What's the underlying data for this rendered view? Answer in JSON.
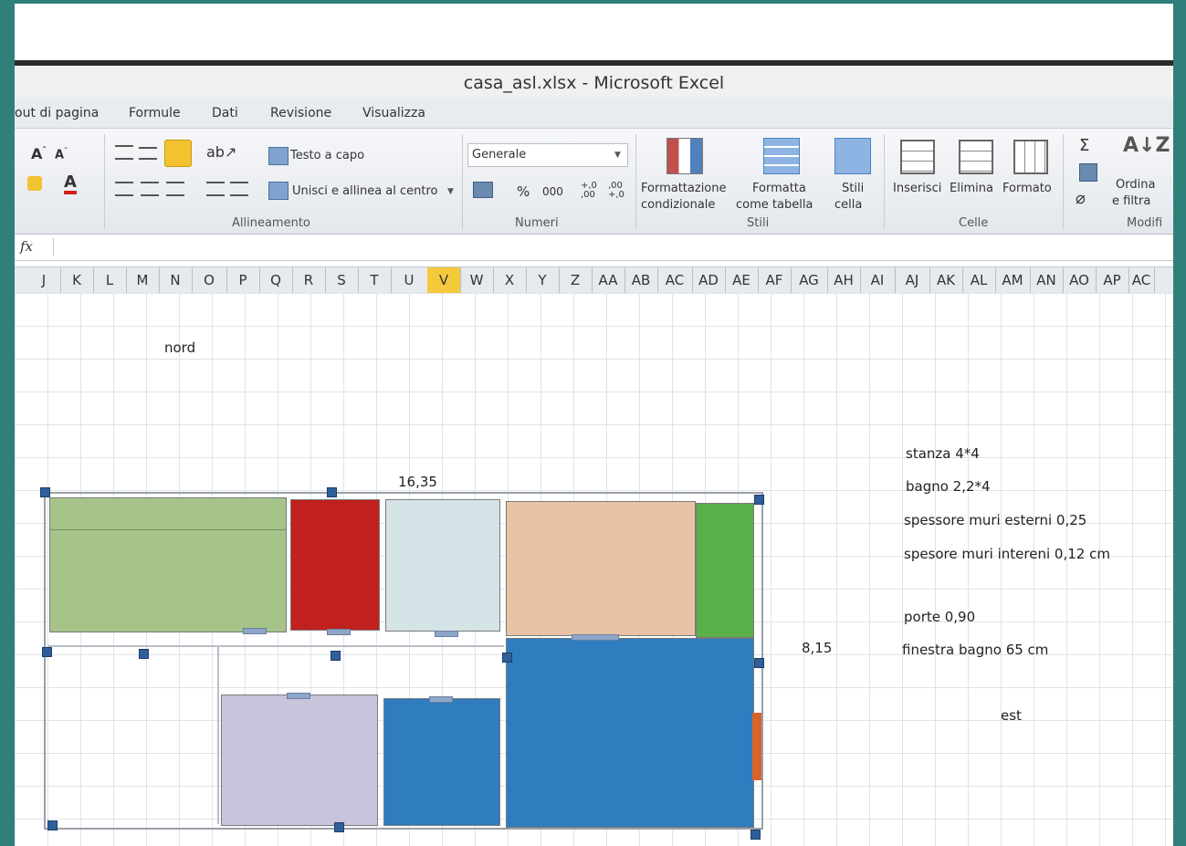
{
  "window": {
    "title": "casa_asl.xlsx - Microsoft Excel"
  },
  "tabs": [
    "out di pagina",
    "Formule",
    "Dati",
    "Revisione",
    "Visualizza"
  ],
  "ribbon": {
    "wrap_text": "Testo a capo",
    "merge_center": "Unisci e allinea al centro",
    "number_format": "Generale",
    "percent": "%",
    "thousands": "000",
    "cond_format_1": "Formattazione",
    "cond_format_2": "condizionale",
    "format_table_1": "Formatta",
    "format_table_2": "come tabella",
    "cell_styles_1": "Stili",
    "cell_styles_2": "cella",
    "insert": "Inserisci",
    "delete": "Elimina",
    "format": "Formato",
    "sort_1": "Ordina",
    "sort_2": "e filtra",
    "sigma": "Σ",
    "groups": {
      "alignment": "Allineamento",
      "numbers": "Numeri",
      "styles": "Stili",
      "cells": "Celle",
      "editing": "Modifi"
    }
  },
  "formula_bar": {
    "fx": "fx"
  },
  "columns": [
    "J",
    "K",
    "L",
    "M",
    "N",
    "O",
    "P",
    "Q",
    "R",
    "S",
    "T",
    "U",
    "V",
    "W",
    "X",
    "Y",
    "Z",
    "AA",
    "AB",
    "AC",
    "AD",
    "AE",
    "AF",
    "AG",
    "AH",
    "AI",
    "AJ",
    "AK",
    "AL",
    "AM",
    "AN",
    "AO",
    "AP",
    "AC"
  ],
  "selected_column": "V",
  "sheet": {
    "nord": "nord",
    "width_dim": "16,35",
    "height_dim": "8,15",
    "est": "est",
    "notes": [
      "stanza 4*4",
      "bagno 2,2*4",
      "spessore muri esterni 0,25",
      "spesore muri intereni 0,12 cm",
      "porte 0,90",
      "finestra bagno 65 cm"
    ]
  },
  "colors": {
    "room_green_light": "#a6c48a",
    "room_red": "#c0201e",
    "room_pale_blue": "#d4e4e6",
    "room_peach": "#e8c3a6",
    "room_green": "#5ab04a",
    "room_lavender": "#c8c4dc",
    "room_blue": "#2f7cbf",
    "window_orange": "#d8642c",
    "selected_col": "#f5c93c"
  }
}
